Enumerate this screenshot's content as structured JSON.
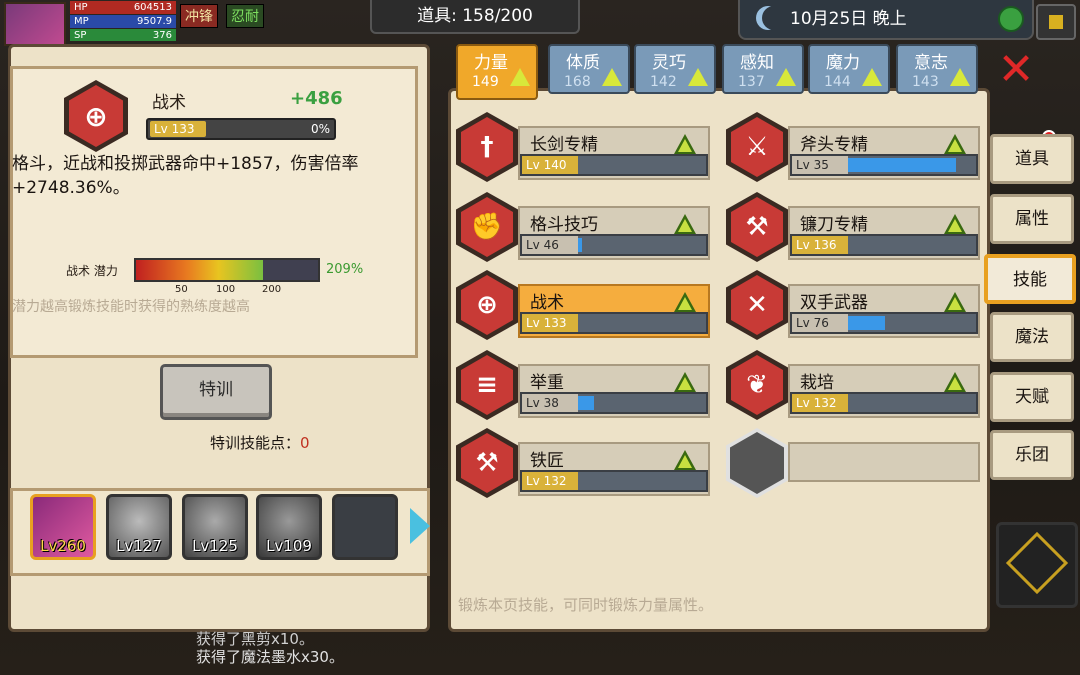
{
  "hud": {
    "hp_label": "HP",
    "hp": "604513",
    "mp_label": "MP",
    "mp": "9507.9",
    "sp_label": "SP",
    "sp": "376",
    "tag1": "冲锋",
    "tag2": "忍耐"
  },
  "top": {
    "items": "道具: 158/200",
    "date": "10月25日  晚上"
  },
  "detail": {
    "name": "战术",
    "bonus": "+486",
    "level": "Lv 133",
    "percent": "0%",
    "desc": "格斗，近战和投掷武器命中+1857，伤害倍率+2748.36%。",
    "potential_label": "战术  潜力",
    "ticks": [
      "50",
      "100",
      "200"
    ],
    "potential_percent": "209%",
    "potential_value": 209,
    "potential_max": 300,
    "hint": "潜力越高锻炼技能时获得的熟练度越高"
  },
  "train": {
    "button": "特训",
    "points_label": "特训技能点：",
    "points": "0"
  },
  "party": [
    {
      "lv": "Lv260"
    },
    {
      "lv": "Lv127"
    },
    {
      "lv": "Lv125"
    },
    {
      "lv": "Lv109"
    }
  ],
  "log": [
    "获得了黑剪x10。",
    "获得了魔法墨水x30。"
  ],
  "tabs": [
    {
      "name": "力量",
      "value": "149"
    },
    {
      "name": "体质",
      "value": "168"
    },
    {
      "name": "灵巧",
      "value": "142"
    },
    {
      "name": "感知",
      "value": "137"
    },
    {
      "name": "魔力",
      "value": "144"
    },
    {
      "name": "意志",
      "value": "143"
    }
  ],
  "skills": [
    {
      "name": "长剑专精",
      "level": "Lv 140",
      "progress": 0,
      "gold": true,
      "icon": "sword-icon",
      "glyph": "†"
    },
    {
      "name": "斧头专精",
      "level": "Lv 35",
      "progress": 0.82,
      "gold": false,
      "icon": "axe-icon",
      "glyph": "⚔"
    },
    {
      "name": "格斗技巧",
      "level": "Lv 46",
      "progress": 0.03,
      "gold": false,
      "icon": "fist-icon",
      "glyph": "✊"
    },
    {
      "name": "镰刀专精",
      "level": "Lv 136",
      "progress": 0,
      "gold": true,
      "icon": "scythe-icon",
      "glyph": "⚒"
    },
    {
      "name": "战术",
      "level": "Lv 133",
      "progress": 0,
      "gold": true,
      "icon": "tactics-icon",
      "glyph": "⊕"
    },
    {
      "name": "双手武器",
      "level": "Lv 76",
      "progress": 0.28,
      "gold": false,
      "icon": "two-handed-icon",
      "glyph": "✕"
    },
    {
      "name": "举重",
      "level": "Lv 38",
      "progress": 0.12,
      "gold": false,
      "icon": "barbell-icon",
      "glyph": "≡"
    },
    {
      "name": "栽培",
      "level": "Lv 132",
      "progress": 0,
      "gold": true,
      "icon": "plant-icon",
      "glyph": "❦"
    },
    {
      "name": "铁匠",
      "level": "Lv 132",
      "progress": 0,
      "gold": true,
      "icon": "anvil-icon",
      "glyph": "⚒"
    }
  ],
  "right_hint": "锻炼本页技能，可同时锻炼力量属性。",
  "side_tabs": [
    "道具",
    "属性",
    "技能",
    "魔法",
    "天赋",
    "乐团"
  ]
}
